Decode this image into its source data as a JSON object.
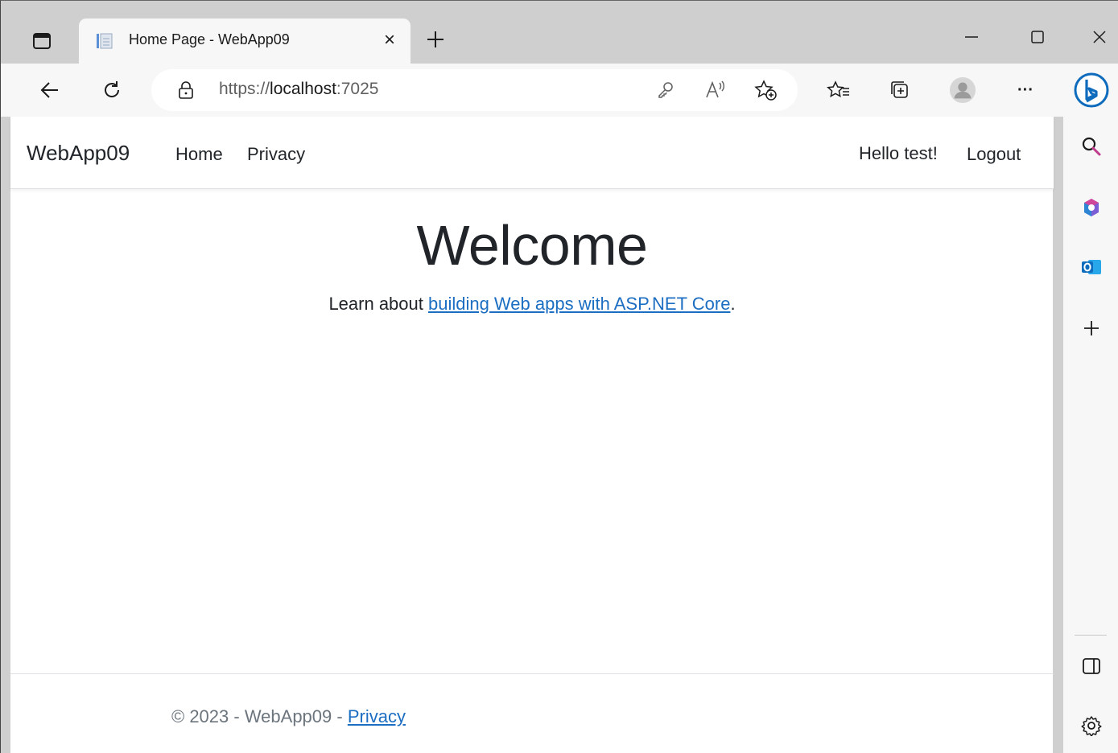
{
  "browser": {
    "tab": {
      "title": "Home Page - WebApp09",
      "favicon": "document-icon",
      "close": "×"
    },
    "new_tab": "+",
    "address": {
      "scheme": "https://",
      "host": "localhost",
      "port": ":7025"
    },
    "icons": [
      "tab-actions-icon",
      "back-arrow-icon",
      "refresh-icon",
      "lock-icon",
      "key-icon",
      "read-aloud-icon",
      "add-favorite-icon",
      "favorites-icon",
      "collections-icon",
      "profile-avatar-icon",
      "more-icon",
      "bing-copilot-icon",
      "minimize-icon",
      "maximize-icon",
      "close-window-icon"
    ],
    "sidebar_icons": [
      "search-icon",
      "office-icon",
      "outlook-icon",
      "add-icon",
      "sidebar-toggle-icon",
      "settings-icon"
    ],
    "more_label": "···",
    "accent": "#0f6cbd"
  },
  "site": {
    "brand": "WebApp09",
    "nav": [
      {
        "label": "Home"
      },
      {
        "label": "Privacy"
      }
    ],
    "greeting": "Hello test!",
    "logout": "Logout",
    "heading": "Welcome",
    "lead_prefix": "Learn about ",
    "lead_link": "building Web apps with ASP.NET Core",
    "lead_suffix": ".",
    "footer_prefix": "© 2023 - WebApp09 - ",
    "footer_link": "Privacy",
    "link_color": "#1b6ec2"
  }
}
